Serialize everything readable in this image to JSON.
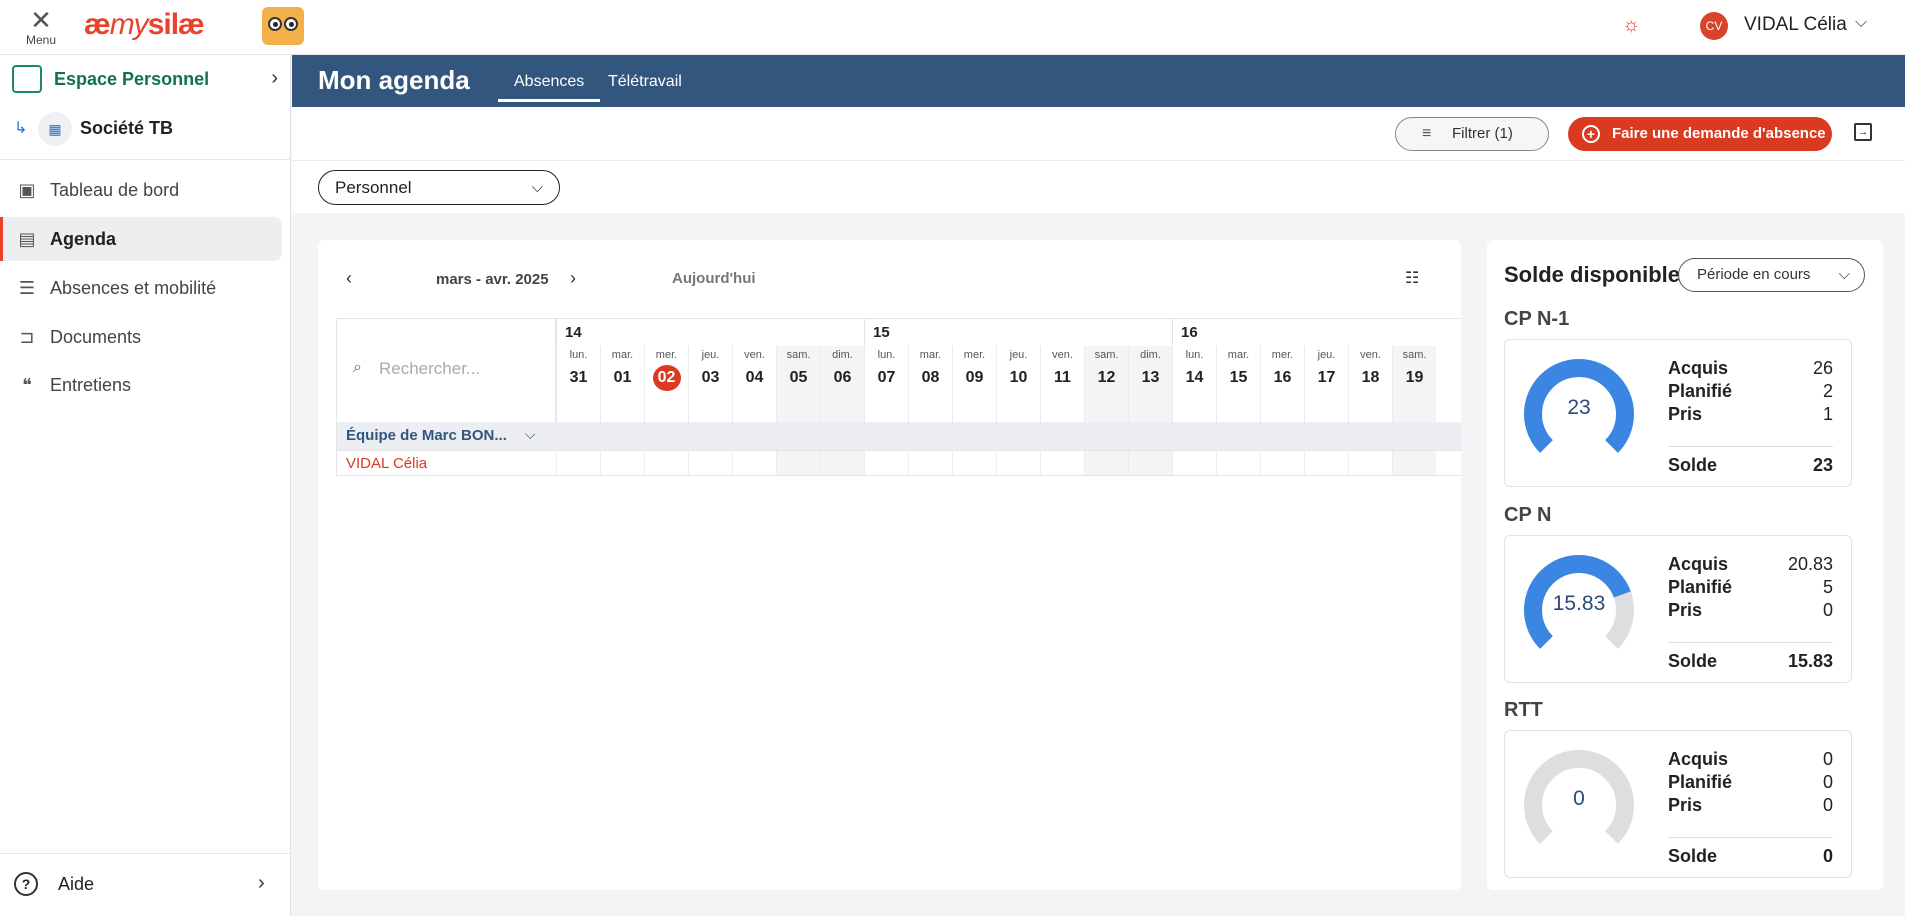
{
  "topbar": {
    "menu_label": "Menu",
    "logo_prefix": "æ",
    "logo_my": "my",
    "logo_name": "silæ",
    "user_initials": "CV",
    "user_name": "VIDAL Célia"
  },
  "sidebar": {
    "space_label": "Espace Personnel",
    "company_label": "Société TB",
    "items": [
      {
        "label": "Tableau de bord",
        "icon": "dashboard-icon"
      },
      {
        "label": "Agenda",
        "icon": "calendar-icon",
        "active": true
      },
      {
        "label": "Absences et mobilité",
        "icon": "list-icon"
      },
      {
        "label": "Documents",
        "icon": "folder-icon"
      },
      {
        "label": "Entretiens",
        "icon": "chat-icon"
      }
    ],
    "help_label": "Aide"
  },
  "header": {
    "title": "Mon agenda",
    "tabs": [
      {
        "label": "Absences"
      },
      {
        "label": "Télétravail"
      }
    ]
  },
  "toolbar": {
    "filter_label": "Filtrer (1)",
    "request_label": "Faire une demande d'absence"
  },
  "view_select": {
    "value": "Personnel"
  },
  "calendar": {
    "range_label": "mars - avr. 2025",
    "today_label": "Aujourd'hui",
    "search_placeholder": "Rechercher...",
    "weeks": [
      "14",
      "15",
      "16"
    ],
    "days": [
      {
        "name": "lun.",
        "num": "31"
      },
      {
        "name": "mar.",
        "num": "01"
      },
      {
        "name": "mer.",
        "num": "02",
        "current": true
      },
      {
        "name": "jeu.",
        "num": "03"
      },
      {
        "name": "ven.",
        "num": "04"
      },
      {
        "name": "sam.",
        "num": "05",
        "weekend": true
      },
      {
        "name": "dim.",
        "num": "06",
        "weekend": true
      },
      {
        "name": "lun.",
        "num": "07"
      },
      {
        "name": "mar.",
        "num": "08"
      },
      {
        "name": "mer.",
        "num": "09"
      },
      {
        "name": "jeu.",
        "num": "10"
      },
      {
        "name": "ven.",
        "num": "11"
      },
      {
        "name": "sam.",
        "num": "12",
        "weekend": true
      },
      {
        "name": "dim.",
        "num": "13",
        "weekend": true
      },
      {
        "name": "lun.",
        "num": "14"
      },
      {
        "name": "mar.",
        "num": "15"
      },
      {
        "name": "mer.",
        "num": "16"
      },
      {
        "name": "jeu.",
        "num": "17"
      },
      {
        "name": "ven.",
        "num": "18"
      },
      {
        "name": "sam.",
        "num": "19",
        "weekend": true
      }
    ],
    "team_label": "Équipe de Marc BON...",
    "person_label": "VIDAL Célia"
  },
  "balance": {
    "title": "Solde disponible",
    "period_label": "Période en cours",
    "sections": [
      {
        "title": "CP N-1",
        "gauge_value": "23",
        "fill": 1.0,
        "acquis": "26",
        "planifie": "2",
        "pris": "1",
        "solde": "23"
      },
      {
        "title": "CP N",
        "gauge_value": "15.83",
        "fill": 0.76,
        "acquis": "20.83",
        "planifie": "5",
        "pris": "0",
        "solde": "15.83"
      },
      {
        "title": "RTT",
        "gauge_value": "0",
        "fill": 0.0,
        "acquis": "0",
        "planifie": "0",
        "pris": "0",
        "solde": "0"
      }
    ],
    "labels": {
      "acquis": "Acquis",
      "planifie": "Planifié",
      "pris": "Pris",
      "solde": "Solde"
    }
  },
  "colors": {
    "accent": "#d93a20",
    "header_bg": "#33567e",
    "gauge_fill": "#3b86e2",
    "gauge_track": "#dedede",
    "brand_green": "#11724f"
  }
}
